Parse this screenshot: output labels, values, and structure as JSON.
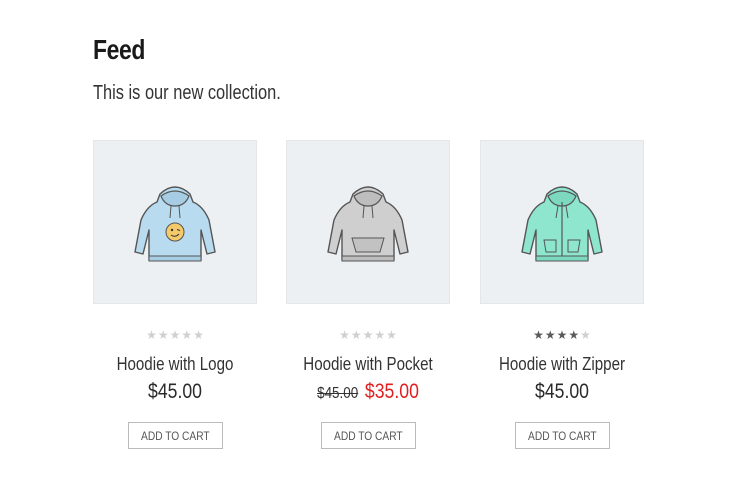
{
  "page": {
    "title": "Feed",
    "subtitle": "This is our new collection."
  },
  "products": [
    {
      "name": "Hoodie with Logo",
      "price": "$45.00",
      "rating": 0,
      "add_to_cart": "ADD TO CART",
      "color": "#b9dbef",
      "icon": "hoodie-logo-icon"
    },
    {
      "name": "Hoodie with Pocket",
      "old_price": "$45.00",
      "price": "$35.00",
      "rating": 0,
      "add_to_cart": "ADD TO CART",
      "color": "#c8c8c8",
      "icon": "hoodie-pocket-icon"
    },
    {
      "name": "Hoodie with Zipper",
      "price": "$45.00",
      "rating": 4,
      "add_to_cart": "ADD TO CART",
      "color": "#8ee6cf",
      "icon": "hoodie-zipper-icon"
    }
  ],
  "colors": {
    "sale": "#e02020",
    "thumb_bg": "#ecf0f3"
  }
}
